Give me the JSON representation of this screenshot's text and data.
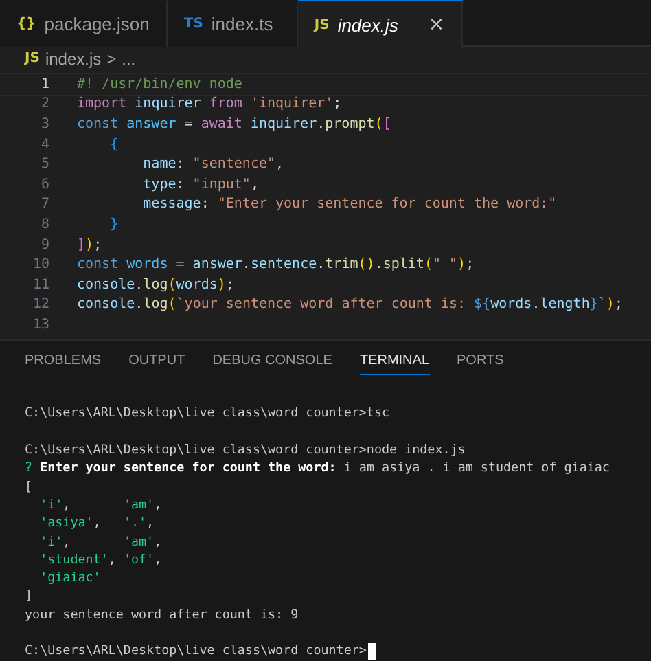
{
  "editor_tabs": [
    {
      "icon": "{}",
      "color": "#cbcb41",
      "label": "package.json",
      "selected": false
    },
    {
      "icon": "TS",
      "color": "#3178c6",
      "label": "index.ts",
      "selected": false
    },
    {
      "icon": "JS",
      "color": "#cbcb41",
      "label": "index.js",
      "selected": true,
      "close": "×"
    }
  ],
  "breadcrumb": {
    "icon": "JS",
    "file": "index.js",
    "separator": ">",
    "rest": "..."
  },
  "code_lines": [
    {
      "number": "1",
      "current": true,
      "tokens": [
        {
          "kind": "comment",
          "text": "#! /usr/bin/env node"
        }
      ]
    },
    {
      "number": "2",
      "current": false,
      "tokens": [
        {
          "kind": "keyword",
          "text": "import "
        },
        {
          "kind": "variable",
          "text": "inquirer "
        },
        {
          "kind": "keyword",
          "text": "from "
        },
        {
          "kind": "string",
          "text": "'inquirer'"
        },
        {
          "kind": "plain",
          "text": ";"
        }
      ]
    },
    {
      "number": "3",
      "current": false,
      "tokens": [
        {
          "kind": "storage",
          "text": "const "
        },
        {
          "kind": "constant",
          "text": "answer"
        },
        {
          "kind": "plain",
          "text": " = "
        },
        {
          "kind": "keyword",
          "text": "await "
        },
        {
          "kind": "variable",
          "text": "inquirer"
        },
        {
          "kind": "plain",
          "text": "."
        },
        {
          "kind": "function",
          "text": "prompt"
        },
        {
          "kind": "bracket1",
          "text": "("
        },
        {
          "kind": "bracket2",
          "text": "["
        }
      ]
    },
    {
      "number": "4",
      "current": false,
      "tokens": [
        {
          "kind": "bracket3",
          "text": "    {"
        }
      ]
    },
    {
      "number": "5",
      "current": false,
      "tokens": [
        {
          "kind": "variable",
          "text": "        name"
        },
        {
          "kind": "plain",
          "text": ": "
        },
        {
          "kind": "string",
          "text": "\"sentence\""
        },
        {
          "kind": "plain",
          "text": ","
        }
      ]
    },
    {
      "number": "6",
      "current": false,
      "tokens": [
        {
          "kind": "variable",
          "text": "        type"
        },
        {
          "kind": "plain",
          "text": ": "
        },
        {
          "kind": "string",
          "text": "\"input\""
        },
        {
          "kind": "plain",
          "text": ","
        }
      ]
    },
    {
      "number": "7",
      "current": false,
      "tokens": [
        {
          "kind": "variable",
          "text": "        message"
        },
        {
          "kind": "plain",
          "text": ": "
        },
        {
          "kind": "string",
          "text": "\"Enter your sentence for count the word:\""
        }
      ]
    },
    {
      "number": "8",
      "current": false,
      "tokens": [
        {
          "kind": "bracket3",
          "text": "    }"
        }
      ]
    },
    {
      "number": "9",
      "current": false,
      "tokens": [
        {
          "kind": "bracket2",
          "text": "]"
        },
        {
          "kind": "bracket1",
          "text": ")"
        },
        {
          "kind": "plain",
          "text": ";"
        }
      ]
    },
    {
      "number": "10",
      "current": false,
      "tokens": [
        {
          "kind": "storage",
          "text": "const "
        },
        {
          "kind": "constant",
          "text": "words"
        },
        {
          "kind": "plain",
          "text": " = "
        },
        {
          "kind": "variable",
          "text": "answer"
        },
        {
          "kind": "plain",
          "text": "."
        },
        {
          "kind": "variable",
          "text": "sentence"
        },
        {
          "kind": "plain",
          "text": "."
        },
        {
          "kind": "function",
          "text": "trim"
        },
        {
          "kind": "bracket1",
          "text": "()"
        },
        {
          "kind": "plain",
          "text": "."
        },
        {
          "kind": "function",
          "text": "split"
        },
        {
          "kind": "bracket1",
          "text": "("
        },
        {
          "kind": "string",
          "text": "\" \""
        },
        {
          "kind": "bracket1",
          "text": ")"
        },
        {
          "kind": "plain",
          "text": ";"
        }
      ]
    },
    {
      "number": "11",
      "current": false,
      "tokens": [
        {
          "kind": "variable",
          "text": "console"
        },
        {
          "kind": "plain",
          "text": "."
        },
        {
          "kind": "function",
          "text": "log"
        },
        {
          "kind": "bracket1",
          "text": "("
        },
        {
          "kind": "variable",
          "text": "words"
        },
        {
          "kind": "bracket1",
          "text": ")"
        },
        {
          "kind": "plain",
          "text": ";"
        }
      ]
    },
    {
      "number": "12",
      "current": false,
      "tokens": [
        {
          "kind": "variable",
          "text": "console"
        },
        {
          "kind": "plain",
          "text": "."
        },
        {
          "kind": "function",
          "text": "log"
        },
        {
          "kind": "bracket1",
          "text": "("
        },
        {
          "kind": "string",
          "text": "`your sentence word after count is: "
        },
        {
          "kind": "storage",
          "text": "${"
        },
        {
          "kind": "variable",
          "text": "words"
        },
        {
          "kind": "plain",
          "text": "."
        },
        {
          "kind": "variable",
          "text": "length"
        },
        {
          "kind": "storage",
          "text": "}"
        },
        {
          "kind": "string",
          "text": "`"
        },
        {
          "kind": "bracket1",
          "text": ")"
        },
        {
          "kind": "plain",
          "text": ";"
        }
      ]
    },
    {
      "number": "13",
      "current": false
    }
  ],
  "panel_tabs": [
    {
      "label": "PROBLEMS",
      "selected": false
    },
    {
      "label": "OUTPUT",
      "selected": false
    },
    {
      "label": "DEBUG CONSOLE",
      "selected": false
    },
    {
      "label": "TERMINAL",
      "selected": true
    },
    {
      "label": "PORTS",
      "selected": false
    }
  ],
  "terminal_lines": [
    {
      "kind": "blank"
    },
    {
      "tokens": [
        {
          "kind": "plain",
          "text": "C:\\Users\\ARL\\Desktop\\live class\\word counter>tsc"
        }
      ]
    },
    {
      "kind": "blank"
    },
    {
      "tokens": [
        {
          "kind": "plain",
          "text": "C:\\Users\\ARL\\Desktop\\live class\\word counter>node index.js"
        }
      ]
    },
    {
      "tokens": [
        {
          "kind": "mark",
          "text": "? "
        },
        {
          "kind": "bold",
          "text": "Enter your sentence for count the word:"
        },
        {
          "kind": "plain",
          "text": " i am asiya . i am student of giaiac"
        }
      ]
    },
    {
      "tokens": [
        {
          "kind": "plain",
          "text": "["
        }
      ]
    },
    {
      "tokens": [
        {
          "kind": "string",
          "text": "  'i'"
        },
        {
          "kind": "plain",
          "text": ",       "
        },
        {
          "kind": "string",
          "text": "'am'"
        },
        {
          "kind": "plain",
          "text": ","
        }
      ]
    },
    {
      "tokens": [
        {
          "kind": "string",
          "text": "  'asiya'"
        },
        {
          "kind": "plain",
          "text": ",   "
        },
        {
          "kind": "string",
          "text": "'.'"
        },
        {
          "kind": "plain",
          "text": ","
        }
      ]
    },
    {
      "tokens": [
        {
          "kind": "string",
          "text": "  'i'"
        },
        {
          "kind": "plain",
          "text": ",       "
        },
        {
          "kind": "string",
          "text": "'am'"
        },
        {
          "kind": "plain",
          "text": ","
        }
      ]
    },
    {
      "tokens": [
        {
          "kind": "string",
          "text": "  'student'"
        },
        {
          "kind": "plain",
          "text": ", "
        },
        {
          "kind": "string",
          "text": "'of'"
        },
        {
          "kind": "plain",
          "text": ","
        }
      ]
    },
    {
      "tokens": [
        {
          "kind": "string",
          "text": "  'giaiac'"
        }
      ]
    },
    {
      "tokens": [
        {
          "kind": "plain",
          "text": "]"
        }
      ]
    },
    {
      "tokens": [
        {
          "kind": "plain",
          "text": "your sentence word after count is: 9"
        }
      ]
    },
    {
      "kind": "blank"
    },
    {
      "tokens": [
        {
          "kind": "plain",
          "text": "C:\\Users\\ARL\\Desktop\\live class\\word counter>"
        }
      ],
      "cursor": true
    }
  ]
}
